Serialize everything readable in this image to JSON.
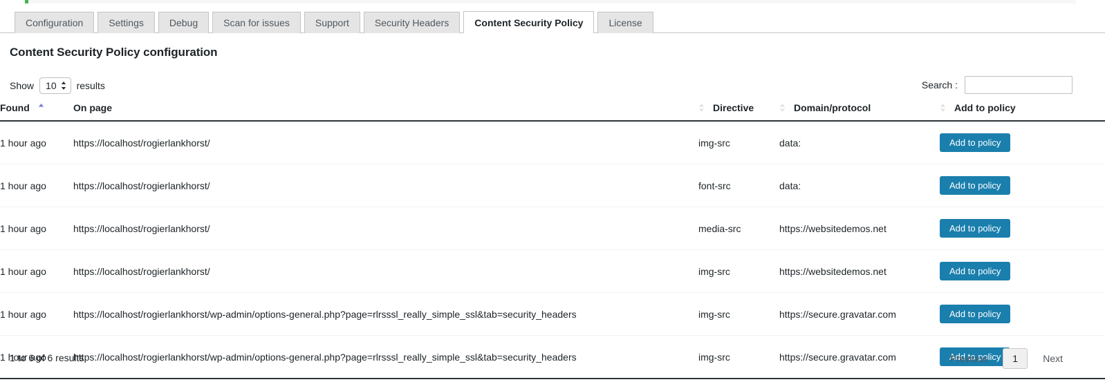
{
  "tabs": [
    {
      "label": "Configuration",
      "active": false
    },
    {
      "label": "Settings",
      "active": false
    },
    {
      "label": "Debug",
      "active": false
    },
    {
      "label": "Scan for issues",
      "active": false
    },
    {
      "label": "Support",
      "active": false
    },
    {
      "label": "Security Headers",
      "active": false
    },
    {
      "label": "Content Security Policy",
      "active": true
    },
    {
      "label": "License",
      "active": false
    }
  ],
  "page_title": "Content Security Policy configuration",
  "controls": {
    "length_prefix": "Show",
    "length_value": "10",
    "length_suffix": "results",
    "search_label": "Search :",
    "search_value": "",
    "search_placeholder": ""
  },
  "table": {
    "columns": [
      {
        "key": "found",
        "label": "Found",
        "sort": "asc",
        "sort_position": "trailing"
      },
      {
        "key": "onpage",
        "label": "On page",
        "sort": "none",
        "sort_position": "none"
      },
      {
        "key": "dir",
        "label": "Directive",
        "sort": "none",
        "sort_position": "leading"
      },
      {
        "key": "dom",
        "label": "Domain/protocol",
        "sort": "none",
        "sort_position": "leading"
      },
      {
        "key": "add",
        "label": "Add to policy",
        "sort": "none",
        "sort_position": "leading"
      }
    ],
    "rows": [
      {
        "found": "1 hour ago",
        "onpage": "https://localhost/rogierlankhorst/",
        "dir": "img-src",
        "dom": "data:",
        "action": "Add to policy"
      },
      {
        "found": "1 hour ago",
        "onpage": "https://localhost/rogierlankhorst/",
        "dir": "font-src",
        "dom": "data:",
        "action": "Add to policy"
      },
      {
        "found": "1 hour ago",
        "onpage": "https://localhost/rogierlankhorst/",
        "dir": "media-src",
        "dom": "https://websitedemos.net",
        "action": "Add to policy"
      },
      {
        "found": "1 hour ago",
        "onpage": "https://localhost/rogierlankhorst/",
        "dir": "img-src",
        "dom": "https://websitedemos.net",
        "action": "Add to policy"
      },
      {
        "found": "1 hour ago",
        "onpage": "https://localhost/rogierlankhorst/wp-admin/options-general.php?page=rlrsssl_really_simple_ssl&tab=security_headers",
        "dir": "img-src",
        "dom": "https://secure.gravatar.com",
        "action": "Add to policy"
      },
      {
        "found": "1 hour ago",
        "onpage": "https://localhost/rogierlankhorst/wp-admin/options-general.php?page=rlrsssl_really_simple_ssl&tab=security_headers",
        "dir": "img-src",
        "dom": "https://secure.gravatar.com",
        "action": "Add to policy"
      }
    ]
  },
  "footer": {
    "info": "1 to 6 of 6 results",
    "previous": "Previous",
    "current_page": "1",
    "next": "Next"
  },
  "colors": {
    "accent_button": "#1a7fad",
    "sort_active": "#7b7fd6",
    "sort_inactive": "#e3e3e3",
    "notice_green": "#46b450",
    "tab_inactive_bg": "#e5e5e5",
    "border": "#c3c4c7"
  }
}
